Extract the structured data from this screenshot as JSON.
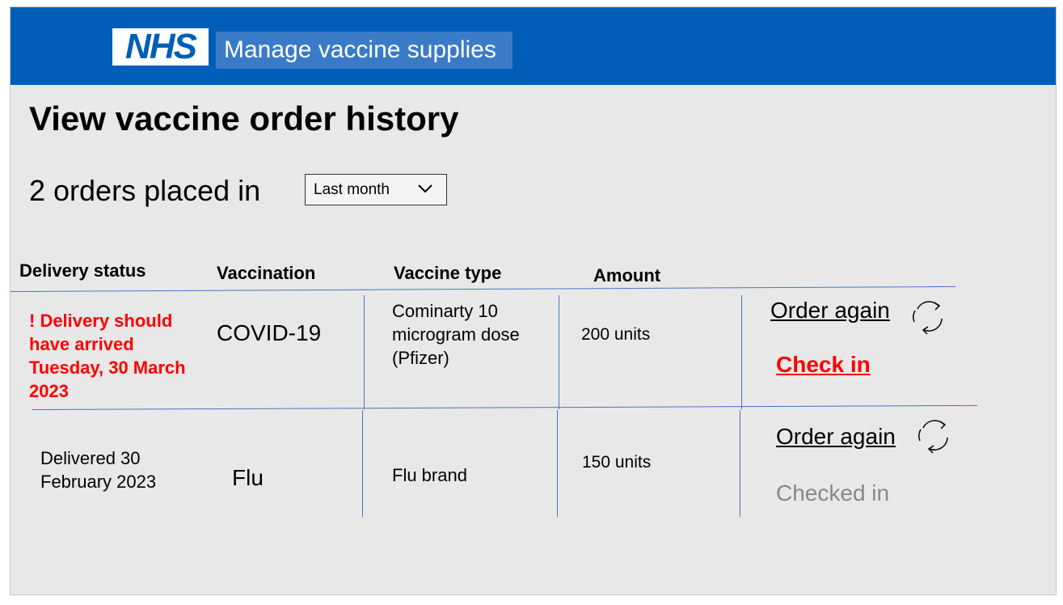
{
  "header": {
    "logo_text": "NHS",
    "service_name": "Manage vaccine supplies",
    "brand_color": "#005eb8"
  },
  "page": {
    "title": "View vaccine order history",
    "orders_count": "2 orders placed in",
    "period_select": {
      "value": "Last month"
    }
  },
  "table": {
    "headers": {
      "status": "Delivery status",
      "vaccination": "Vaccination",
      "type": "Vaccine type",
      "amount": "Amount"
    },
    "rows": [
      {
        "status": "! Delivery should have arrived Tuesday, 30 March 2023",
        "status_kind": "alert",
        "vaccination": "COVID-19",
        "type": "Cominarty 10 microgram dose (Pfizer)",
        "amount": "200 units",
        "order_again": "Order again",
        "check_in": "Check in",
        "reorder_icon": "refresh-icon"
      },
      {
        "status": "Delivered 30 February 2023",
        "status_kind": "ok",
        "vaccination": "Flu",
        "type": "Flu brand",
        "amount": "150 units",
        "order_again": "Order again",
        "check_in_status": "Checked in",
        "reorder_icon": "refresh-icon"
      }
    ]
  },
  "colors": {
    "alert": "#ff0000",
    "muted": "#888888",
    "table_lines": "#4a72c4"
  }
}
